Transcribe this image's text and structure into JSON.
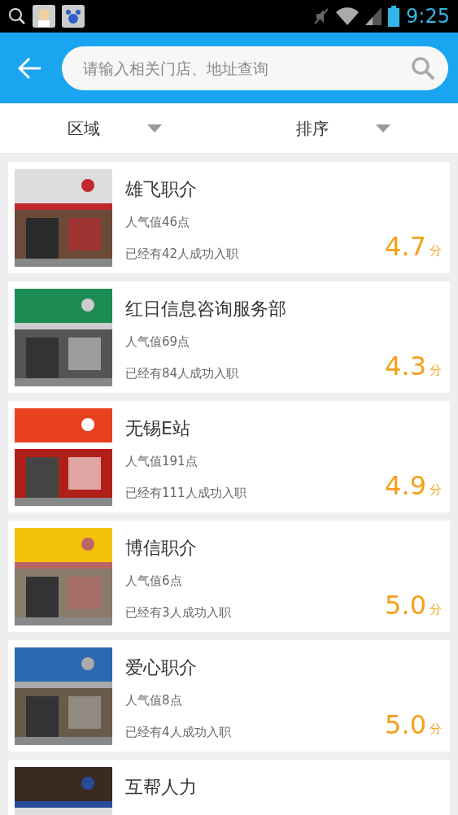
{
  "status_bar": {
    "time": "9:25"
  },
  "header": {
    "search": {
      "placeholder": "请输入相关门店、地址查询"
    }
  },
  "filters": [
    {
      "label": "区域"
    },
    {
      "label": "排序"
    }
  ],
  "stores": [
    {
      "name": "雄飞职介",
      "popularity": "人气值46点",
      "hired": "已经有42人成功入职",
      "score": "4.7",
      "unit": "分",
      "kind": "picture"
    },
    {
      "name": "红日信息咨询服务部",
      "popularity": "人气值69点",
      "hired": "已经有84人成功入职",
      "score": "4.3",
      "unit": "分",
      "kind": "picture"
    },
    {
      "name": "无锡E站",
      "popularity": "人气值191点",
      "hired": "已经有111人成功入职",
      "score": "4.9",
      "unit": "分",
      "kind": "picture"
    },
    {
      "name": "博信职介",
      "popularity": "人气值6点",
      "hired": "已经有3人成功入职",
      "score": "5.0",
      "unit": "分",
      "kind": "picture"
    },
    {
      "name": "爱心职介",
      "popularity": "人气值8点",
      "hired": "已经有4人成功入职",
      "score": "5.0",
      "unit": "分",
      "kind": "picture"
    },
    {
      "name": "互帮人力",
      "kind": "picture"
    }
  ]
}
